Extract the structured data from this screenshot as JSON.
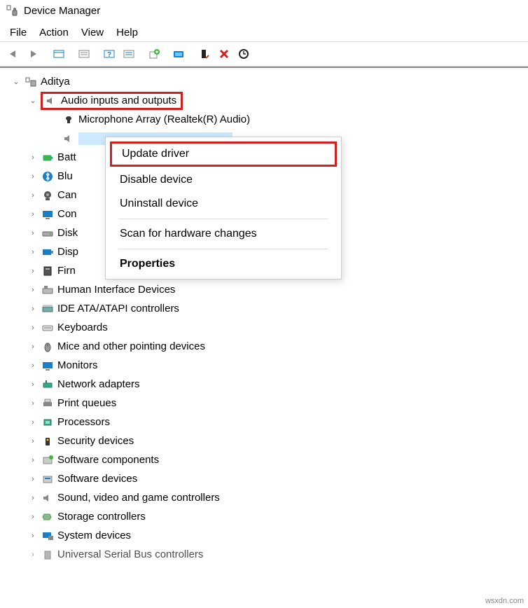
{
  "window": {
    "title": "Device Manager"
  },
  "menu": {
    "file": "File",
    "action": "Action",
    "view": "View",
    "help": "Help"
  },
  "tree": {
    "root": "Aditya",
    "audio_category": "Audio inputs and outputs",
    "audio_child1": "Microphone Array (Realtek(R) Audio)",
    "categories": {
      "batteries": "Batt",
      "bluetooth": "Blu",
      "cameras": "Can",
      "computer": "Con",
      "disk": "Disk",
      "display": "Disp",
      "firmware": "Firn",
      "hid": "Human Interface Devices",
      "ide": "IDE ATA/ATAPI controllers",
      "keyboards": "Keyboards",
      "mice": "Mice and other pointing devices",
      "monitors": "Monitors",
      "network": "Network adapters",
      "printqueues": "Print queues",
      "processors": "Processors",
      "security": "Security devices",
      "swcomponents": "Software components",
      "swdevices": "Software devices",
      "sound": "Sound, video and game controllers",
      "storage": "Storage controllers",
      "system": "System devices",
      "usb": "Universal Serial Bus controllers"
    }
  },
  "context_menu": {
    "update": "Update driver",
    "disable": "Disable device",
    "uninstall": "Uninstall device",
    "scan": "Scan for hardware changes",
    "properties": "Properties"
  },
  "watermark": "wsxdn.com"
}
